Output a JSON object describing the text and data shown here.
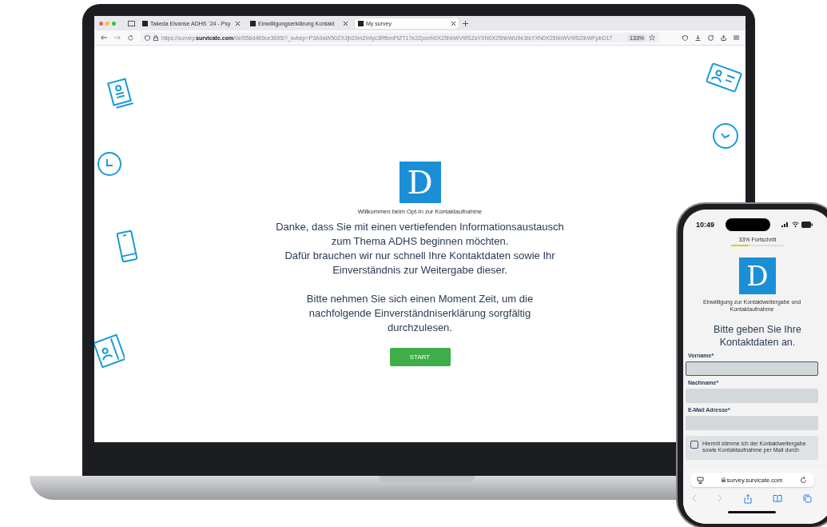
{
  "browser": {
    "tabs": [
      {
        "label": "Takeda Elvanse ADHS ´24 - Psy",
        "selected": false
      },
      {
        "label": "Einwilligungserklärung Kontakt",
        "selected": false
      },
      {
        "label": "My survey",
        "selected": true
      }
    ],
    "url": "https://survey.**survicate.com**/0ef356d469ce3695/?_svbep=P3A9aW50ZXJjb20mZmlyc3RfbmFtZT17e2ZpcnN0X25hbWV9fSZsYXN0X25hbWU9e3tsYXN0X25hbWV9fSZlbWFpbD17",
    "zoom": "133%"
  },
  "laptop_page": {
    "logo": "D",
    "subtitle": "Willkommen beim Opt-In zur Kontaktaufnahme",
    "intro": "Danke, dass Sie mit  einen vertiefenden  Informationsaustausch\nzum Thema ADHS beginnen möchten.\nDafür brauchen wir nur schnell Ihre Kontaktdaten sowie Ihr\nEinverständnis zur Weitergabe dieser.",
    "note": "Bitte nehmen Sie sich einen Moment Zeit, um die\nnachfolgende Einverständniserklärung sorgfältig\ndurchzulesen.",
    "button": "START"
  },
  "phone": {
    "time": "10:49",
    "progress_label": "33% Fortschritt",
    "progress": {
      "level": 0.33
    },
    "logo": "D",
    "subtitle": "Einwilligung zur Kontaktweitergabe und Kontaktaufnahme",
    "heading": "Bitte geben Sie Ihre Kontaktdaten an.",
    "fields": [
      {
        "label": "Vorname*",
        "focused": true
      },
      {
        "label": "Nachname*",
        "focused": false
      },
      {
        "label": "E-Mail Adresse*",
        "focused": false
      }
    ],
    "consent": {
      "checked": false,
      "text": "Hiermit stimme ich der Kontaktweitergabe sowie Kontaktaufnahme per Mail durch"
    },
    "address": "survey.survicate.com"
  }
}
